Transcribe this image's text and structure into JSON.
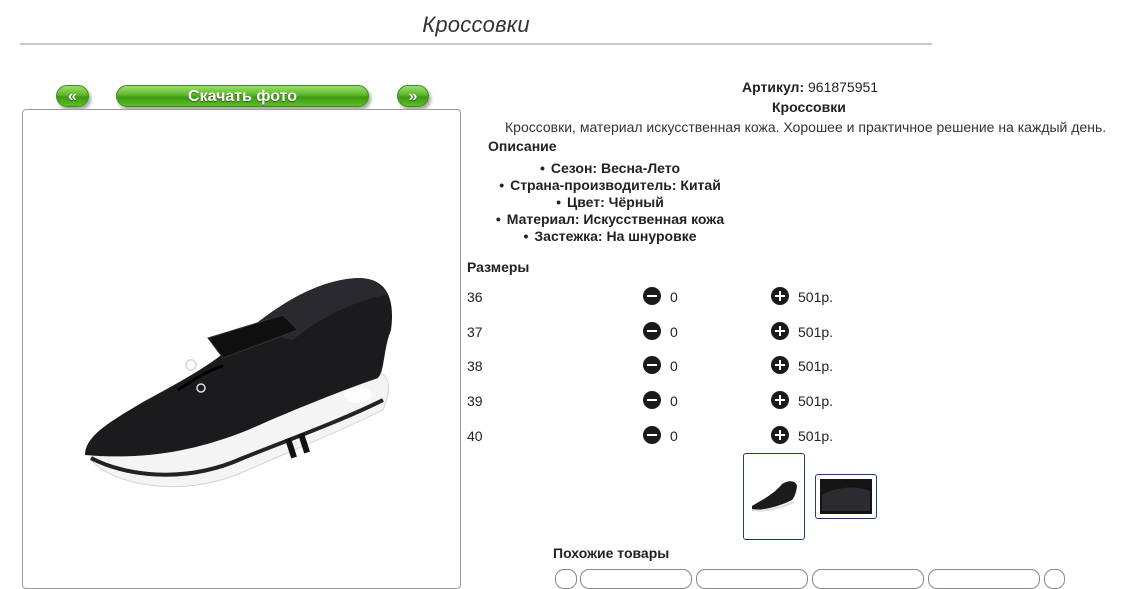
{
  "page": {
    "title": "Кроссовки"
  },
  "gallery": {
    "prev_label": "«",
    "download_label": "Скачать фото",
    "next_label": "»"
  },
  "product": {
    "article_label": "Артикул:",
    "article_value": "961875951",
    "name": "Кроссовки",
    "description": "Кроссовки, материал искусственная кожа. Хорошее и практичное решение на каждый день.",
    "description_heading": "Описание",
    "properties": [
      "Сезон: Весна-Лето",
      "Страна-производитель: Китай",
      "Цвет: Чёрный",
      "Материал: Искусственная кожа",
      "Застежка: На шнуровке"
    ]
  },
  "sizes": {
    "heading": "Размеры",
    "rows": [
      {
        "size": "36",
        "qty": "0",
        "price": "501р."
      },
      {
        "size": "37",
        "qty": "0",
        "price": "501р."
      },
      {
        "size": "38",
        "qty": "0",
        "price": "501р."
      },
      {
        "size": "39",
        "qty": "0",
        "price": "501р."
      },
      {
        "size": "40",
        "qty": "0",
        "price": "501р."
      }
    ]
  },
  "similar": {
    "heading": "Похожие товары"
  },
  "colors": {
    "button_green": "#5cb72a",
    "thumb_border": "#1e3c6a"
  }
}
